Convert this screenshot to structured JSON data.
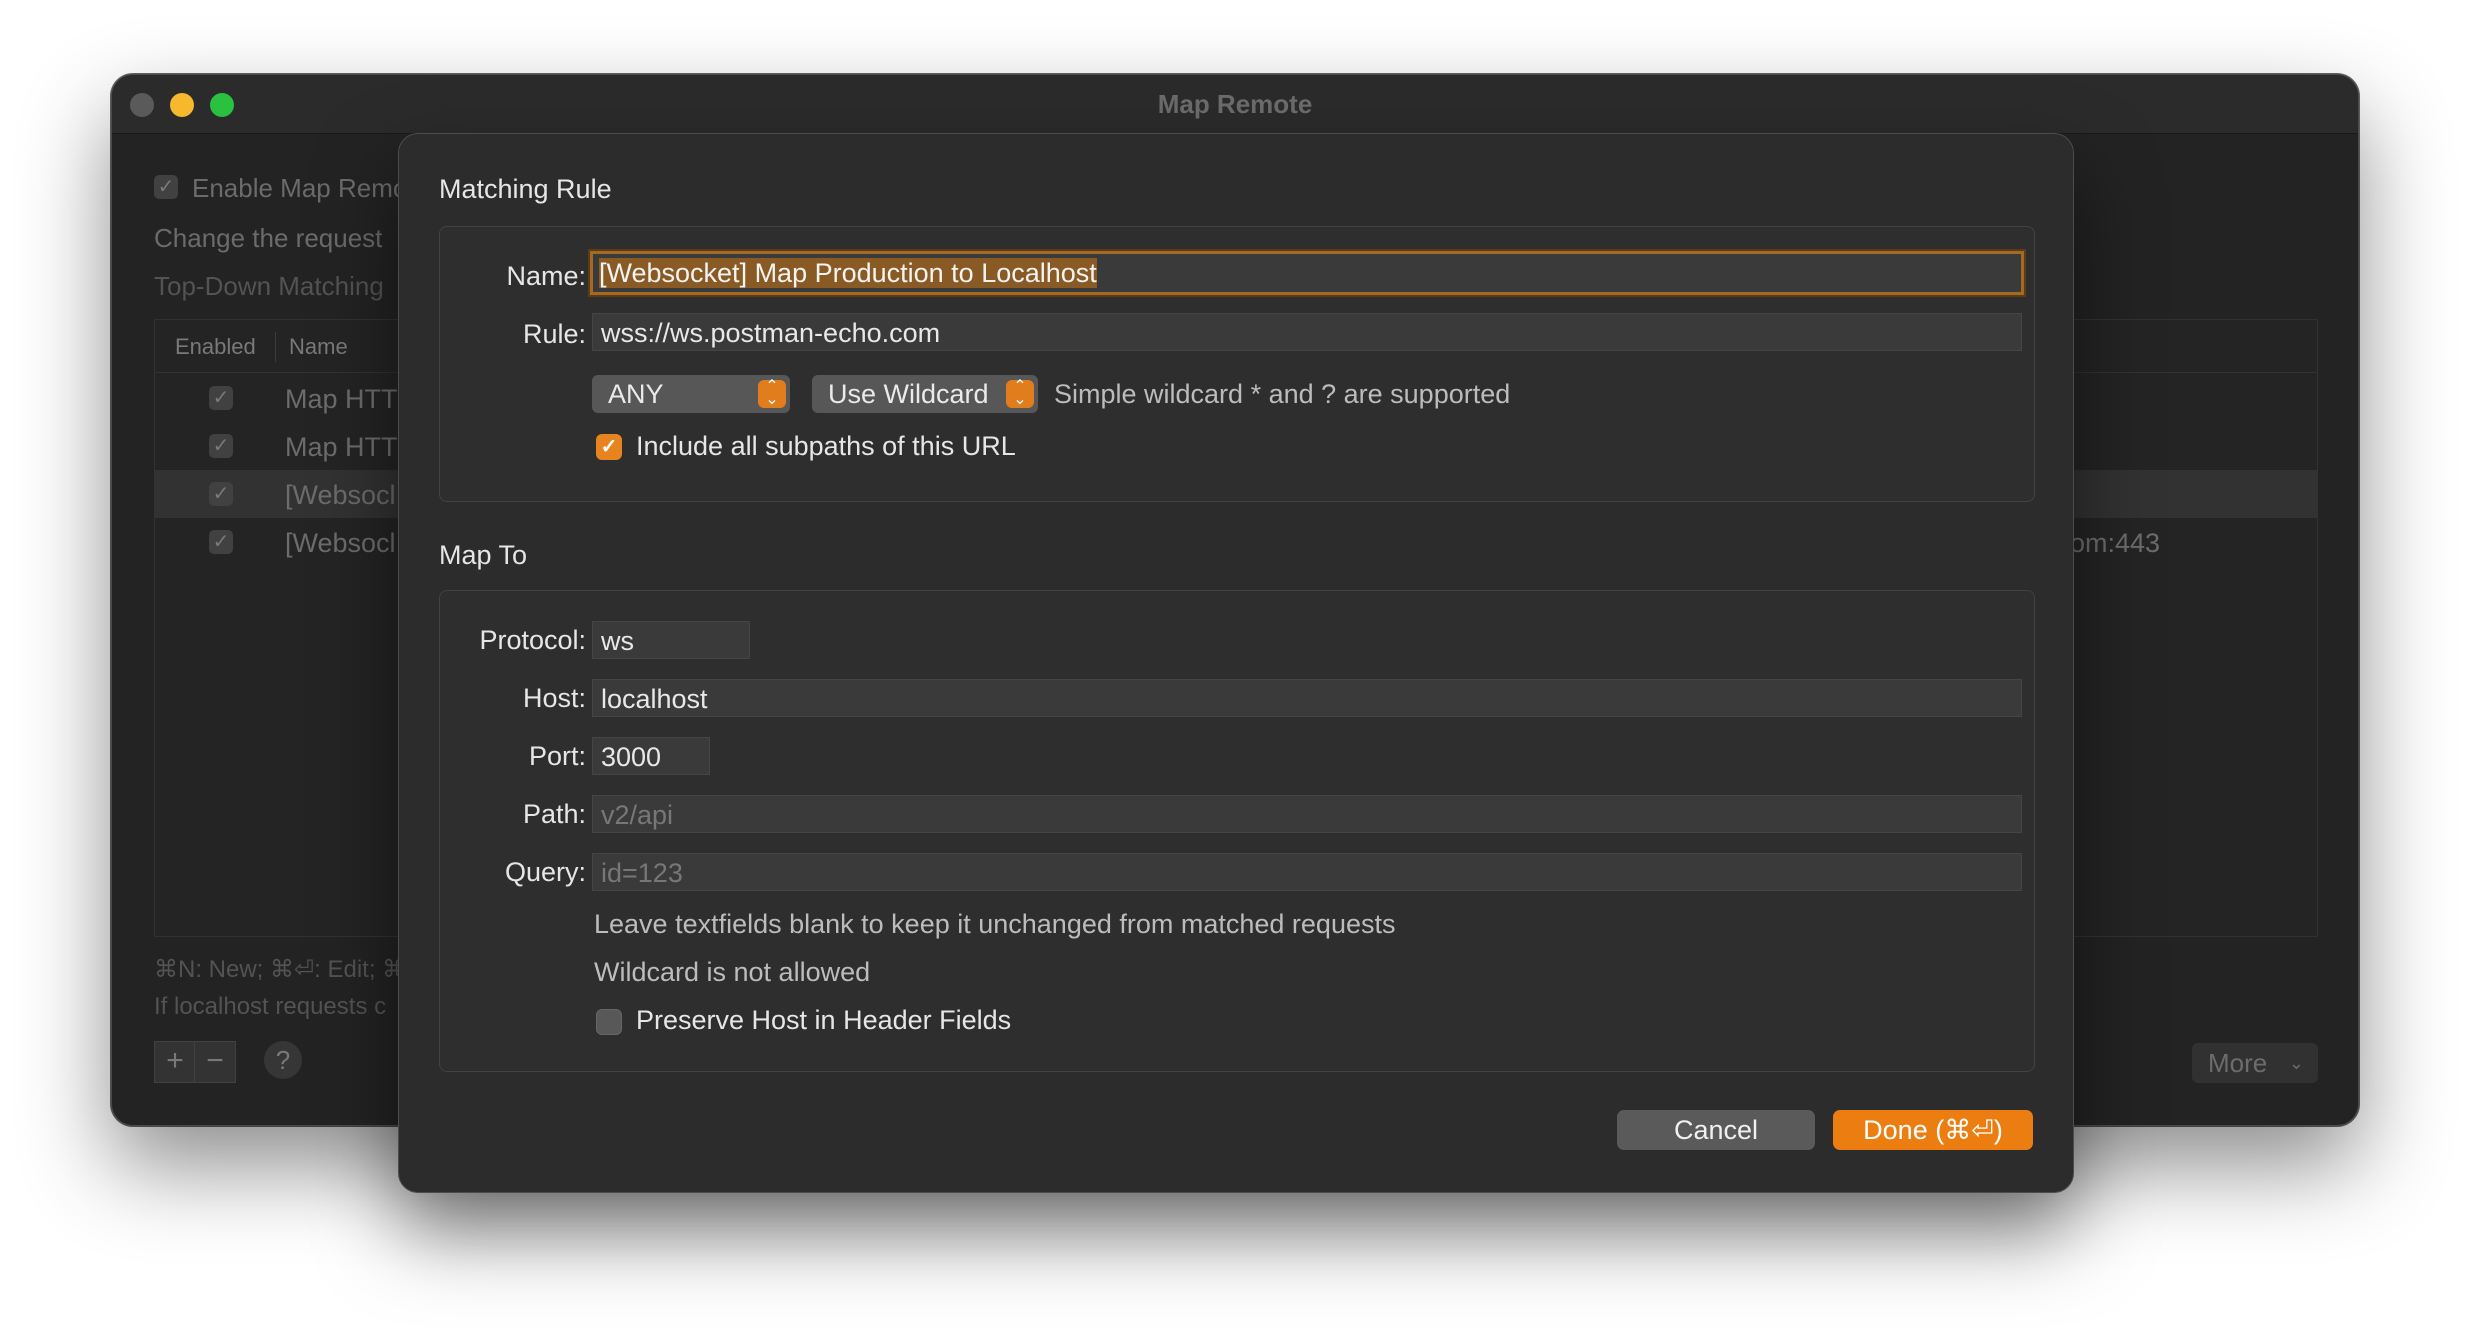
{
  "window": {
    "title": "Map Remote"
  },
  "background": {
    "enable_label": "Enable Map Remo",
    "description": "Change the request",
    "matching_mode": "Top-Down Matching",
    "columns": {
      "enabled": "Enabled",
      "name": "Name"
    },
    "rows": [
      {
        "name": "Map HTT",
        "right": ""
      },
      {
        "name": "Map HTT",
        "right": ""
      },
      {
        "name": "[Websocl",
        "right": ""
      },
      {
        "name": "[Websocl",
        "right": "om:443"
      }
    ],
    "shortcuts_hint": "⌘N: New; ⌘⏎: Edit; ⌘",
    "localhost_hint": "If localhost requests c",
    "add_label": "+",
    "remove_label": "−",
    "help_label": "?",
    "more_label": "More"
  },
  "dialog": {
    "matching_rule": {
      "title": "Matching Rule",
      "name_label": "Name:",
      "name_value": "[Websocket] Map Production to Localhost",
      "rule_label": "Rule:",
      "rule_value": "wss://ws.postman-echo.com",
      "method_value": "ANY",
      "match_mode_value": "Use Wildcard",
      "wildcard_hint": "Simple wildcard * and ? are supported",
      "subpaths_label": "Include all subpaths of this URL"
    },
    "map_to": {
      "title": "Map To",
      "protocol_label": "Protocol:",
      "protocol_value": "ws",
      "host_label": "Host:",
      "host_value": "localhost",
      "port_label": "Port:",
      "port_value": "3000",
      "path_label": "Path:",
      "path_placeholder": "v2/api",
      "query_label": "Query:",
      "query_placeholder": "id=123",
      "blank_hint": "Leave textfields blank to keep it unchanged from matched requests",
      "wildcard_hint": "Wildcard is not allowed",
      "preserve_host_label": "Preserve Host in Header Fields"
    },
    "cancel_label": "Cancel",
    "done_label": "Done (⌘⏎)"
  },
  "colors": {
    "accent": "#ec7d11",
    "window_bg": "#282828",
    "sheet_bg": "#2c2c2c"
  },
  "icons": {
    "checkmark": "checkmark-icon",
    "stepper": "up-down-chevron-icon",
    "chevron": "chevron-down-icon"
  }
}
